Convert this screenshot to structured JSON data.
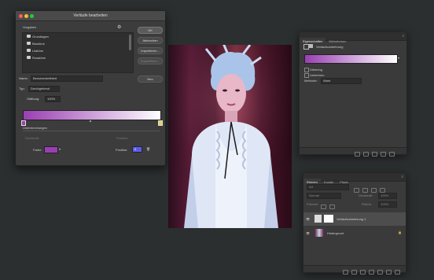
{
  "dialog": {
    "title": "Verläufe bearbeiten",
    "presets_label": "Vorgaben",
    "folders": [
      "Grundlagen",
      "Blautöne",
      "Lilatöne",
      "Rosatöne"
    ],
    "buttons": {
      "ok": "OK",
      "cancel": "Abbrechen",
      "load": "Importieren...",
      "save": "Exportieren..."
    },
    "name_label": "Name:",
    "name_value": "Benutzerdefiniert",
    "new_button": "Neu",
    "type_label": "Typ:",
    "type_value": "Durchgehend",
    "smoothness_label": "Glättung:",
    "smoothness_value": "100%",
    "stops_heading": "Unterbrechungen",
    "opacity_label": "Deckkraft:",
    "location_label": "Position:",
    "delete_label": "Löschen",
    "color_label": "Farbe:",
    "position_label": "Position:",
    "position_value": "0",
    "gradient_start": "#9a3fb3",
    "gradient_end": "#ffffff"
  },
  "properties": {
    "tabs": [
      "Eigenschaften",
      "Bibliotheken"
    ],
    "layer_type": "Verlaufsumkehrung",
    "dither_label": "Dithering",
    "reverse_label": "Umkehren",
    "method_label": "Methode:",
    "method_value": "Wahr"
  },
  "layers": {
    "tabs": [
      "Ebenen",
      "Kanäle",
      "Pfade"
    ],
    "search_placeholder": "Art",
    "blend_mode": "Normal",
    "opacity_label": "Deckkraft:",
    "opacity_value": "100%",
    "lock_label": "Fixieren:",
    "fill_label": "Fläche:",
    "fill_value": "100%",
    "items": [
      {
        "name": "Verlaufsumsetzung 1",
        "kind": "adjustment"
      },
      {
        "name": "Hintergrund",
        "kind": "photo"
      }
    ]
  },
  "colors": {
    "accent": "#9a3fb3",
    "window": "#3c3c3c",
    "background": "#2b2f30"
  }
}
